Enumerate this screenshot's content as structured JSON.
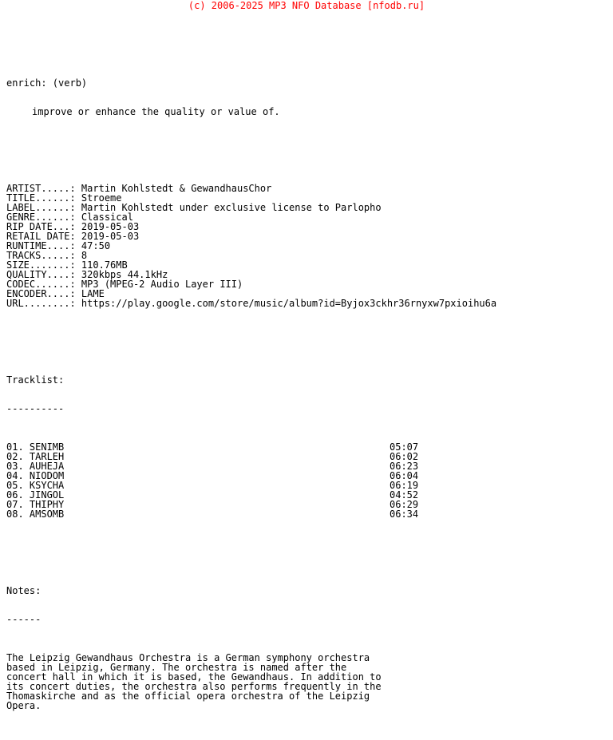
{
  "header": {
    "copyright": "(c) 2006-2025 MP3 NFO Database [nfodb.ru]",
    "color": "#ff0000"
  },
  "definition": {
    "term": "enrich: (verb)",
    "body": "improve or enhance the quality or value of."
  },
  "metadata": {
    "label_width": 11,
    "fields": [
      {
        "label": "ARTIST",
        "padded": "ARTIST.....: ",
        "value": "Martin Kohlstedt & GewandhausChor"
      },
      {
        "label": "TITLE",
        "padded": "TITLE......: ",
        "value": "Stroeme"
      },
      {
        "label": "LABEL",
        "padded": "LABEL......: ",
        "value": "Martin Kohlstedt under exclusive license to Parlopho"
      },
      {
        "label": "GENRE",
        "padded": "GENRE......: ",
        "value": "Classical"
      },
      {
        "label": "RIP DATE",
        "padded": "RIP DATE...: ",
        "value": "2019-05-03"
      },
      {
        "label": "RETAIL DATE",
        "padded": "RETAIL DATE: ",
        "value": "2019-05-03"
      },
      {
        "label": "RUNTIME",
        "padded": "RUNTIME....: ",
        "value": "47:50"
      },
      {
        "label": "TRACKS",
        "padded": "TRACKS.....: ",
        "value": "8"
      },
      {
        "label": "SIZE",
        "padded": "SIZE.......: ",
        "value": "110.76MB"
      },
      {
        "label": "QUALITY",
        "padded": "QUALITY....: ",
        "value": "320kbps 44.1kHz"
      },
      {
        "label": "CODEC",
        "padded": "CODEC......: ",
        "value": "MP3 (MPEG-2 Audio Layer III)"
      },
      {
        "label": "ENCODER",
        "padded": "ENCODER....: ",
        "value": "LAME"
      },
      {
        "label": "URL",
        "padded": "URL........: ",
        "value": "https://play.google.com/store/music/album?id=Byjox3ckhr36rnyxw7pxioihu6a"
      }
    ]
  },
  "tracklist": {
    "title": "Tracklist:",
    "rule": "----------",
    "tracks": [
      {
        "num": "01.",
        "name": "SENIMB",
        "time": "05:07"
      },
      {
        "num": "02.",
        "name": "TARLEH",
        "time": "06:02"
      },
      {
        "num": "03.",
        "name": "AUHEJA",
        "time": "06:23"
      },
      {
        "num": "04.",
        "name": "NIODOM",
        "time": "06:04"
      },
      {
        "num": "05.",
        "name": "KSYCHA",
        "time": "06:19"
      },
      {
        "num": "06.",
        "name": "JINGOL",
        "time": "04:52"
      },
      {
        "num": "07.",
        "name": "THIPHY",
        "time": "06:29"
      },
      {
        "num": "08.",
        "name": "AMSOMB",
        "time": "06:34"
      }
    ]
  },
  "notes": {
    "title": "Notes:",
    "rule": "------",
    "lines": [
      "The Leipzig Gewandhaus Orchestra is a German symphony orchestra",
      "based in Leipzig, Germany. The orchestra is named after the",
      "concert hall in which it is based, the Gewandhaus. In addition to",
      "its concert duties, the orchestra also performs frequently in the",
      "Thomaskirche and as the official opera orchestra of the Leipzig",
      "Opera."
    ]
  }
}
